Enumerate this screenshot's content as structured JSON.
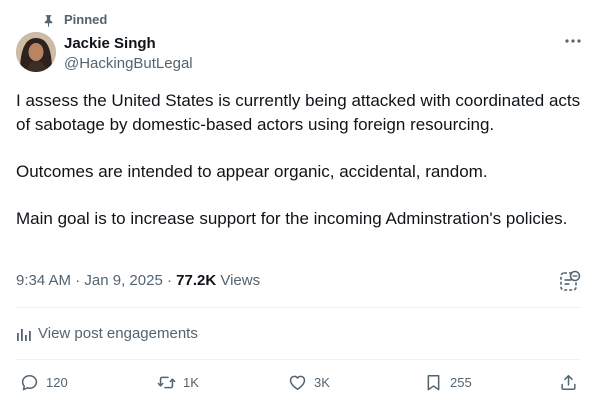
{
  "pinned": {
    "label": "Pinned",
    "icon": "pin-icon"
  },
  "author": {
    "name": "Jackie Singh",
    "handle": "@HackingButLegal",
    "avatar": "profile-photo"
  },
  "tweet": {
    "paragraphs": [
      "I assess the United States is currently being attacked with coordinated acts of sabotage by domestic-based actors using foreign resourcing.",
      "Outcomes are intended to appear organic, accidental, random.",
      "Main goal is to increase support for the incoming Adminstration's policies."
    ]
  },
  "meta": {
    "time": "9:34 AM",
    "separator1": " · ",
    "date": "Jan 9, 2025",
    "separator2": " · ",
    "views_count": "77.2K",
    "views_label": " Views"
  },
  "engagements": {
    "label": "View post engagements",
    "icon": "analytics-bars-icon"
  },
  "actions": {
    "reply": {
      "count": "120",
      "icon": "reply-bubble-icon"
    },
    "repost": {
      "count": "1K",
      "icon": "repost-arrows-icon"
    },
    "like": {
      "count": "3K",
      "icon": "heart-icon"
    },
    "bookmark": {
      "count": "255",
      "icon": "bookmark-icon"
    },
    "share": {
      "icon": "share-upload-icon"
    }
  },
  "colors": {
    "text_primary": "#0f1419",
    "text_secondary": "#536471",
    "divider": "#eff3f4"
  }
}
